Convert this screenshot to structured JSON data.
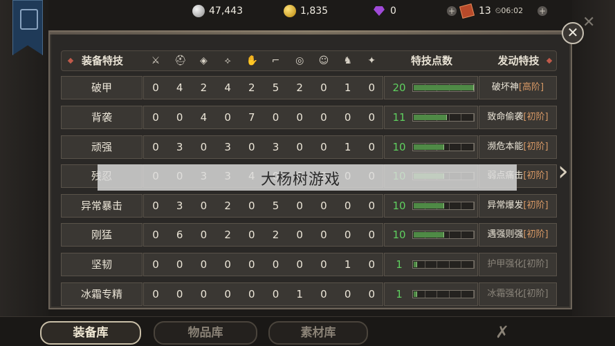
{
  "resources": {
    "silver": "47,443",
    "gold": "1,835",
    "gems": "0",
    "cards": "13",
    "timer": "06:02"
  },
  "table": {
    "header": {
      "skill_col": "装备特技",
      "points_col": "特技点数",
      "trigger_col": "发动特技",
      "slot_icons": [
        "sword-icon",
        "helmet-icon",
        "armor-icon",
        "cloak-icon",
        "gauntlet-icon",
        "boots-icon",
        "ring-icon",
        "mask-icon",
        "mount-icon",
        "trinket-icon"
      ]
    },
    "rows": [
      {
        "name": "破甲",
        "values": [
          "0",
          "4",
          "2",
          "4",
          "2",
          "5",
          "2",
          "0",
          "1",
          "0"
        ],
        "points": "20",
        "level": 1.0,
        "effect": "破坏神",
        "tier": "[高阶]",
        "active": true
      },
      {
        "name": "背袭",
        "values": [
          "0",
          "0",
          "4",
          "0",
          "7",
          "0",
          "0",
          "0",
          "0",
          "0"
        ],
        "points": "11",
        "level": 0.55,
        "effect": "致命偷袭",
        "tier": "[初阶]",
        "active": true
      },
      {
        "name": "顽强",
        "values": [
          "0",
          "3",
          "0",
          "3",
          "0",
          "3",
          "0",
          "0",
          "1",
          "0"
        ],
        "points": "10",
        "level": 0.5,
        "effect": "濒危本能",
        "tier": "[初阶]",
        "active": true
      },
      {
        "name": "残忍",
        "values": [
          "0",
          "0",
          "3",
          "3",
          "4",
          "0",
          "0",
          "0",
          "0",
          "0"
        ],
        "points": "10",
        "level": 0.5,
        "effect": "弱点痛击",
        "tier": "[初阶]",
        "active": true
      },
      {
        "name": "异常暴击",
        "values": [
          "0",
          "3",
          "0",
          "2",
          "0",
          "5",
          "0",
          "0",
          "0",
          "0"
        ],
        "points": "10",
        "level": 0.5,
        "effect": "异常爆发",
        "tier": "[初阶]",
        "active": true
      },
      {
        "name": "刚猛",
        "values": [
          "0",
          "6",
          "0",
          "2",
          "0",
          "2",
          "0",
          "0",
          "0",
          "0"
        ],
        "points": "10",
        "level": 0.5,
        "effect": "遇强则强",
        "tier": "[初阶]",
        "active": true
      },
      {
        "name": "坚韧",
        "values": [
          "0",
          "0",
          "0",
          "0",
          "0",
          "0",
          "0",
          "0",
          "1",
          "0"
        ],
        "points": "1",
        "level": 0.05,
        "effect": "护甲强化",
        "tier": "[初阶]",
        "active": false
      },
      {
        "name": "冰霜专精",
        "values": [
          "0",
          "0",
          "0",
          "0",
          "0",
          "0",
          "1",
          "0",
          "0",
          "0"
        ],
        "points": "1",
        "level": 0.05,
        "effect": "冰霜强化",
        "tier": "[初阶]",
        "active": false
      }
    ]
  },
  "watermark": "大杨树游戏",
  "tabs": {
    "equipment": "装备库",
    "items": "物品库",
    "materials": "素材库"
  },
  "colors": {
    "points_green": "#5fd05f",
    "tier_orange": "#d99a66",
    "bar_fill": "#4f8a46"
  }
}
